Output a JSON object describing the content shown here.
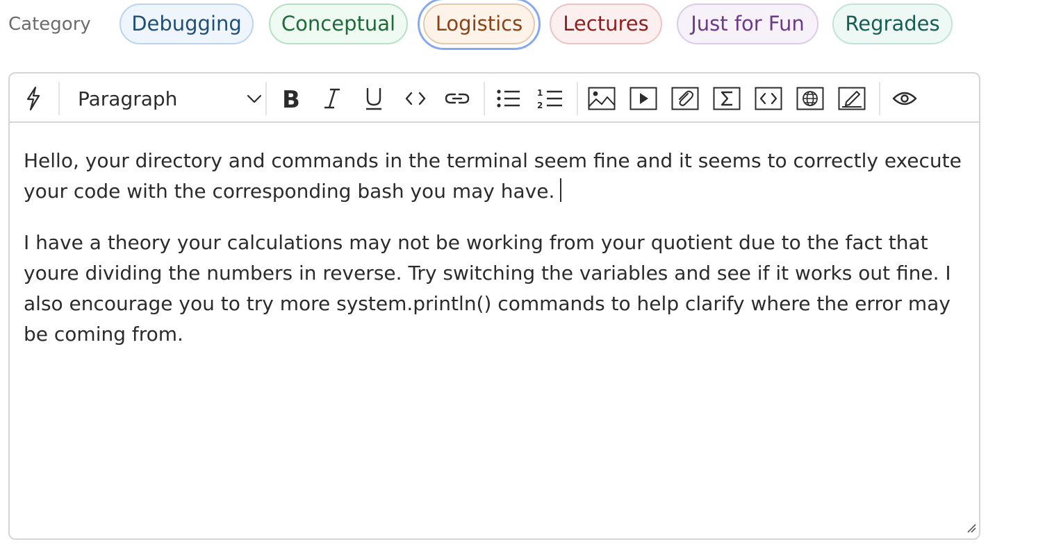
{
  "category": {
    "label": "Category",
    "chips": [
      {
        "label": "Debugging"
      },
      {
        "label": "Conceptual"
      },
      {
        "label": "Logistics",
        "selected": true
      },
      {
        "label": "Lectures"
      },
      {
        "label": "Just for Fun"
      },
      {
        "label": "Regrades"
      }
    ]
  },
  "toolbar": {
    "block_format": "Paragraph",
    "buttons": [
      "lightning-icon",
      "bold-icon",
      "italic-icon",
      "underline-icon",
      "inline-code-icon",
      "link-icon",
      "bullet-list-icon",
      "numbered-list-icon",
      "image-icon",
      "video-icon",
      "attachment-icon",
      "math-icon",
      "code-block-icon",
      "embed-icon",
      "drawing-icon",
      "preview-icon"
    ]
  },
  "editor": {
    "paragraphs": [
      "Hello, your directory and commands in the terminal seem fine and it seems to correctly execute your code with the corresponding bash you may have.",
      "I have a theory your calculations may not be working from your quotient due to the fact that youre dividing the numbers in reverse. Try switching the variables and see if it works out fine. I also encourage you to try more system.println() commands to help clarify where the error may be coming from."
    ]
  },
  "colors": {
    "accent_ring": "#86a8f0",
    "border": "#d5d5d5",
    "text": "#2b2b2b"
  }
}
